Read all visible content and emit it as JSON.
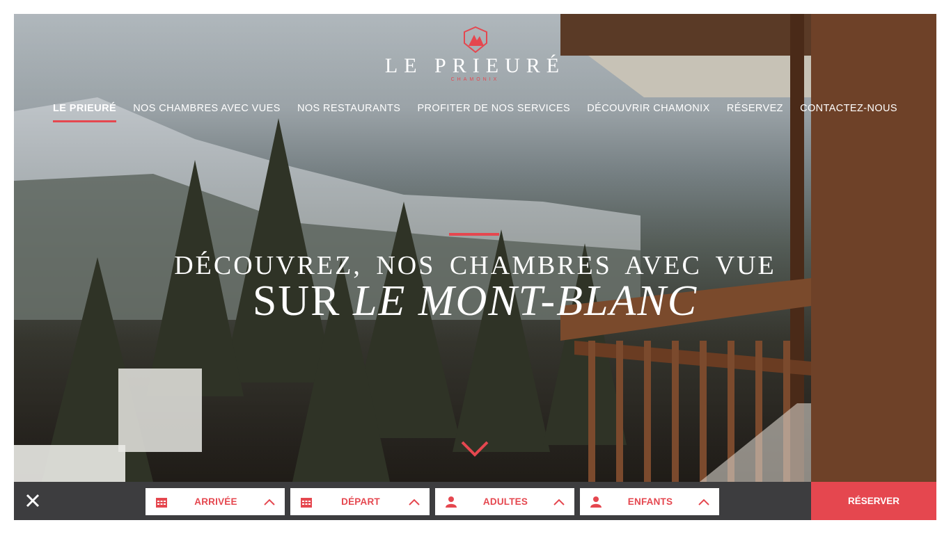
{
  "brand": {
    "title": "LE PRIEURÉ",
    "subtitle": "CHAMONIX"
  },
  "nav": [
    {
      "label": "LE PRIEURÉ",
      "active": true
    },
    {
      "label": "NOS CHAMBRES AVEC VUES"
    },
    {
      "label": "NOS RESTAURANTS"
    },
    {
      "label": "PROFITER DE NOS SERVICES"
    },
    {
      "label": "DÉCOUVRIR CHAMONIX"
    },
    {
      "label": "RÉSERVEZ"
    },
    {
      "label": "CONTACTEZ-NOUS"
    }
  ],
  "hero": {
    "line1": "DÉCOUVREZ, NOS CHAMBRES AVEC VUE",
    "line2_prefix": "SUR ",
    "line2_emphasis": "LE MONT-BLANC"
  },
  "booking": {
    "arrival": "ARRIVÉE",
    "departure": "DÉPART",
    "adults": "ADULTES",
    "children": "ENFANTS",
    "submit": "RÉSERVER"
  },
  "colors": {
    "accent": "#e5474f",
    "bar": "#3d3d3f"
  },
  "icons": {
    "date": "calendar-icon",
    "people": "person-icon",
    "toggle": "chevron-up-icon",
    "close": "close-icon",
    "scroll": "chevron-down-icon"
  }
}
